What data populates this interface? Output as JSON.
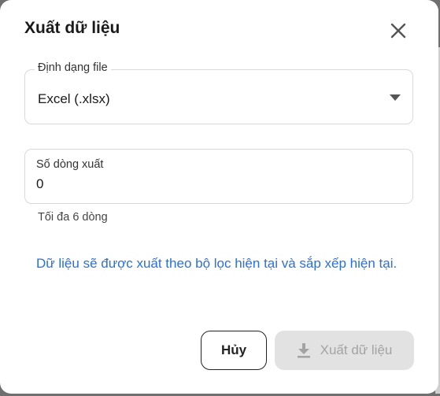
{
  "dialog": {
    "title": "Xuất dữ liệu",
    "close_icon": "close-icon"
  },
  "format_field": {
    "label": "Định dạng file",
    "value": "Excel (.xlsx)",
    "icon": "dropdown-arrow-icon"
  },
  "rows_field": {
    "label": "Số dòng xuất",
    "value": "0",
    "helper": "Tối đa 6 dòng"
  },
  "info_text": "Dữ liệu sẽ được xuất theo bộ lọc hiện tại và sắp xếp hiện tại.",
  "actions": {
    "cancel_label": "Hủy",
    "export_label": "Xuất dữ liệu",
    "export_icon": "download-icon",
    "export_disabled": true
  },
  "colors": {
    "link_blue": "#2a6fe0",
    "disabled_bg": "#e2e2e2",
    "disabled_text": "#a3a3a3"
  }
}
